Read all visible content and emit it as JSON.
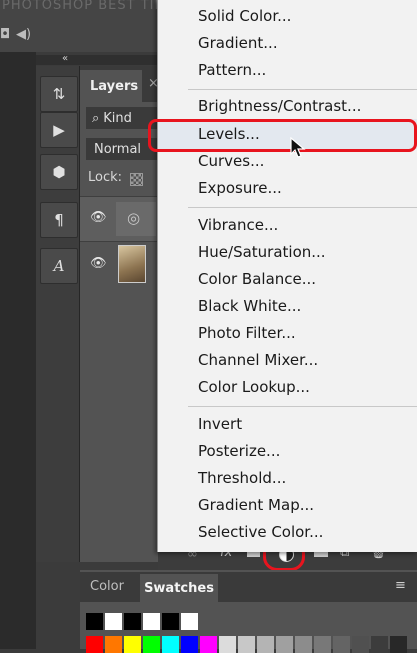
{
  "top": {
    "watermark": "PHOTOSHOP BEST TIPS"
  },
  "tools": {
    "collapse": "«"
  },
  "layers_panel": {
    "tab_label": "Layers",
    "filter_label": "Kind",
    "blend_mode": "Normal",
    "lock_label": "Lock:"
  },
  "menu": {
    "items": [
      "Solid Color...",
      "Gradient...",
      "Pattern...",
      "Brightness/Contrast...",
      "Levels...",
      "Curves...",
      "Exposure...",
      "Vibrance...",
      "Hue/Saturation...",
      "Color Balance...",
      "Black  White...",
      "Photo Filter...",
      "Channel Mixer...",
      "Color Lookup...",
      "Invert",
      "Posterize...",
      "Threshold...",
      "Gradient Map...",
      "Selective Color..."
    ],
    "highlighted": "Levels..."
  },
  "color_panel": {
    "tab_color": "Color",
    "tab_swatches": "Swatches"
  },
  "colors": {
    "annotation_red": "#e8141e",
    "menu_bg": "#f2f2f2",
    "panel_bg": "#535353"
  },
  "swatch_rows": [
    [
      "#000000",
      "#ffffff",
      "#000000",
      "#ffffff",
      "#000000",
      "#ffffff"
    ],
    [
      "#ff0000",
      "#ff7700",
      "#ffff00",
      "#00ff00",
      "#00ffff",
      "#0000ff",
      "#ff00ff",
      "#dcdcdc",
      "#c8c8c8",
      "#b4b4b4",
      "#a0a0a0",
      "#8c8c8c",
      "#787878",
      "#646464",
      "#505050",
      "#3c3c3c",
      "#282828"
    ]
  ]
}
